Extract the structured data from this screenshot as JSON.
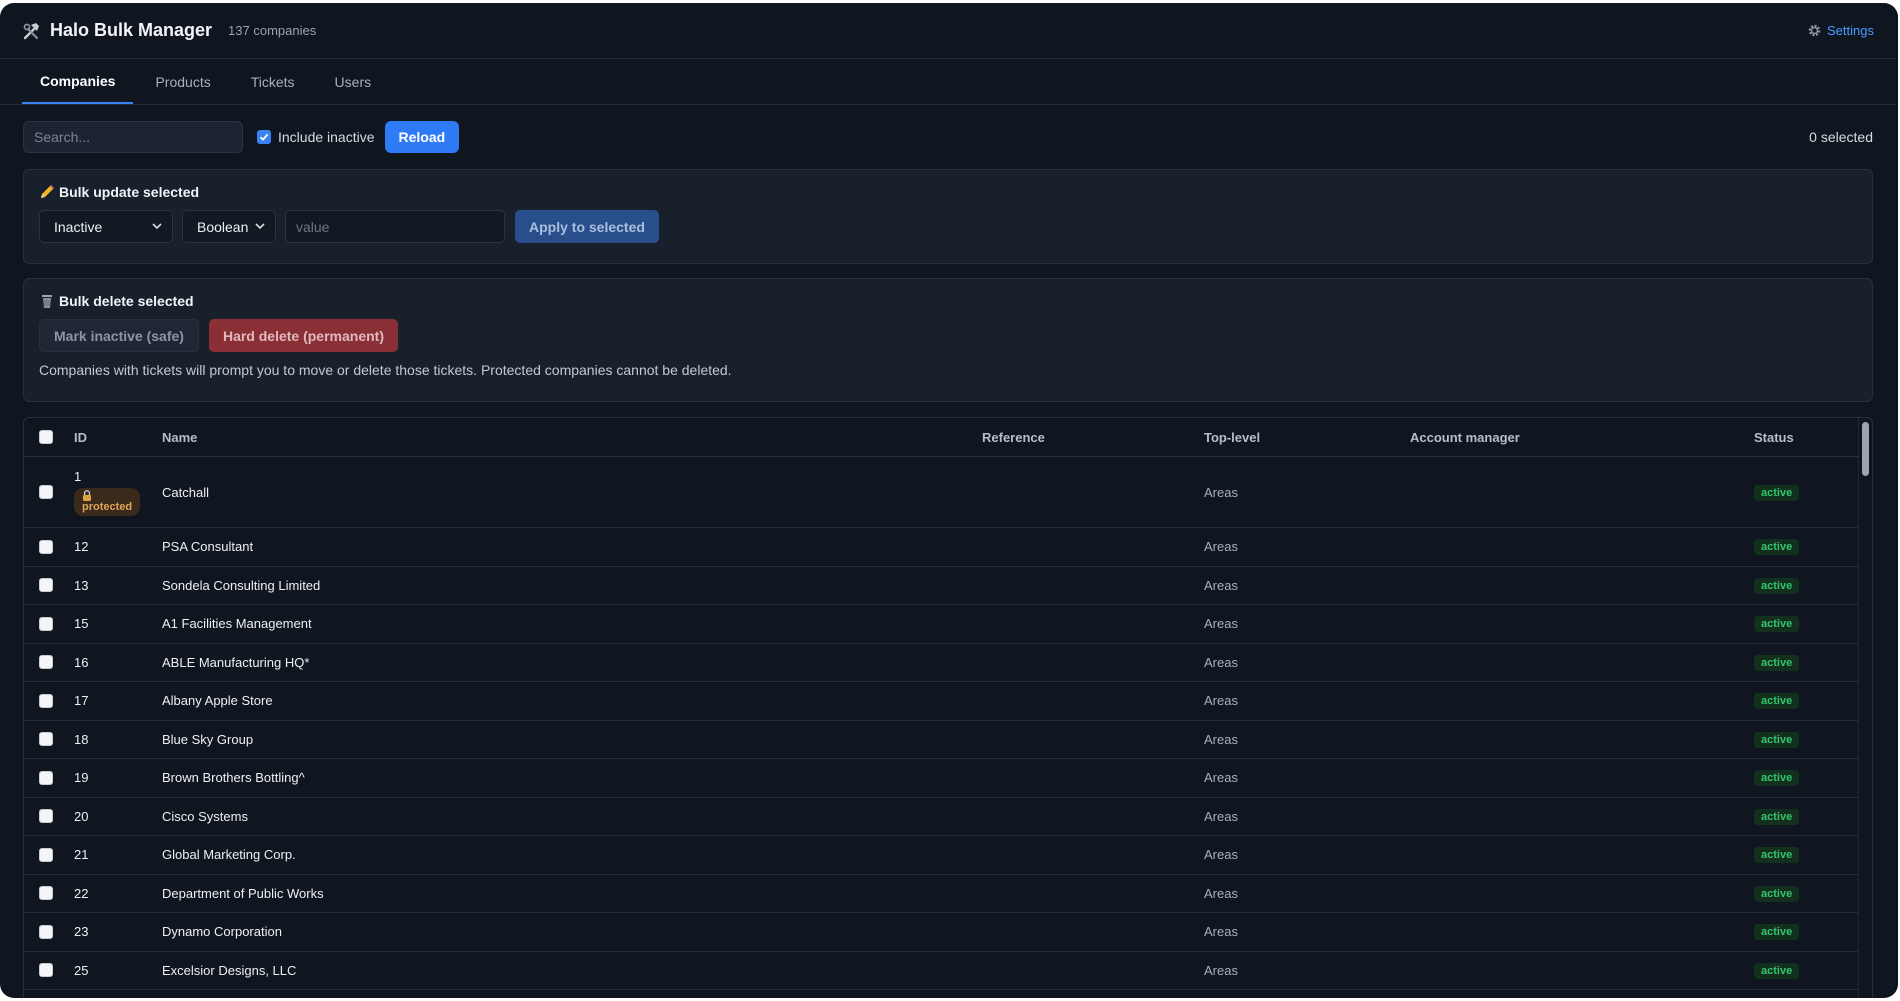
{
  "header": {
    "app_icon": "hammer-wrench-icon",
    "title": "Halo Bulk Manager",
    "company_count": "137 companies",
    "settings_label": "Settings",
    "settings_icon": "gear-icon"
  },
  "tabs": [
    {
      "label": "Companies",
      "active": true
    },
    {
      "label": "Products",
      "active": false
    },
    {
      "label": "Tickets",
      "active": false
    },
    {
      "label": "Users",
      "active": false
    }
  ],
  "toolbar": {
    "search_placeholder": "Search...",
    "search_value": "",
    "include_inactive_label": "Include inactive",
    "include_inactive_checked": true,
    "reload_label": "Reload",
    "selected_count": "0 selected"
  },
  "bulk_update": {
    "icon": "pencil-icon",
    "title": "Bulk update selected",
    "field_select": "Inactive",
    "type_select": "Boolean",
    "value_placeholder": "value",
    "apply_label": "Apply to selected"
  },
  "bulk_delete": {
    "icon": "trash-icon",
    "title": "Bulk delete selected",
    "mark_inactive_label": "Mark inactive (safe)",
    "hard_delete_label": "Hard delete (permanent)",
    "note": "Companies with tickets will prompt you to move or delete those tickets. Protected companies cannot be deleted."
  },
  "table": {
    "columns": {
      "id": "ID",
      "name": "Name",
      "reference": "Reference",
      "top_level": "Top-level",
      "account_manager": "Account manager",
      "status": "Status"
    },
    "rows": [
      {
        "id": "1",
        "name": "Catchall",
        "reference": "",
        "top_level": "Areas",
        "account_manager": "",
        "status": "active",
        "protected": "protected"
      },
      {
        "id": "12",
        "name": "PSA Consultant",
        "reference": "",
        "top_level": "Areas",
        "account_manager": "",
        "status": "active"
      },
      {
        "id": "13",
        "name": "Sondela Consulting Limited",
        "reference": "",
        "top_level": "Areas",
        "account_manager": "",
        "status": "active"
      },
      {
        "id": "15",
        "name": "A1 Facilities Management",
        "reference": "",
        "top_level": "Areas",
        "account_manager": "",
        "status": "active"
      },
      {
        "id": "16",
        "name": "ABLE Manufacturing HQ*",
        "reference": "",
        "top_level": "Areas",
        "account_manager": "",
        "status": "active"
      },
      {
        "id": "17",
        "name": "Albany Apple Store",
        "reference": "",
        "top_level": "Areas",
        "account_manager": "",
        "status": "active"
      },
      {
        "id": "18",
        "name": "Blue Sky Group",
        "reference": "",
        "top_level": "Areas",
        "account_manager": "",
        "status": "active"
      },
      {
        "id": "19",
        "name": "Brown Brothers Bottling^",
        "reference": "",
        "top_level": "Areas",
        "account_manager": "",
        "status": "active"
      },
      {
        "id": "20",
        "name": "Cisco Systems",
        "reference": "",
        "top_level": "Areas",
        "account_manager": "",
        "status": "active"
      },
      {
        "id": "21",
        "name": "Global Marketing Corp.",
        "reference": "",
        "top_level": "Areas",
        "account_manager": "",
        "status": "active"
      },
      {
        "id": "22",
        "name": "Department of Public Works",
        "reference": "",
        "top_level": "Areas",
        "account_manager": "",
        "status": "active"
      },
      {
        "id": "23",
        "name": "Dynamo Corporation",
        "reference": "",
        "top_level": "Areas",
        "account_manager": "",
        "status": "active"
      },
      {
        "id": "25",
        "name": "Excelsior Designs, LLC",
        "reference": "",
        "top_level": "Areas",
        "account_manager": "",
        "status": "active"
      }
    ]
  },
  "colors": {
    "background": "#0f1620",
    "panel": "#17202b",
    "accent": "#2f7bf5",
    "danger": "#8b2f36",
    "status_active": "#35c46b",
    "protected": "#e0a35a"
  }
}
